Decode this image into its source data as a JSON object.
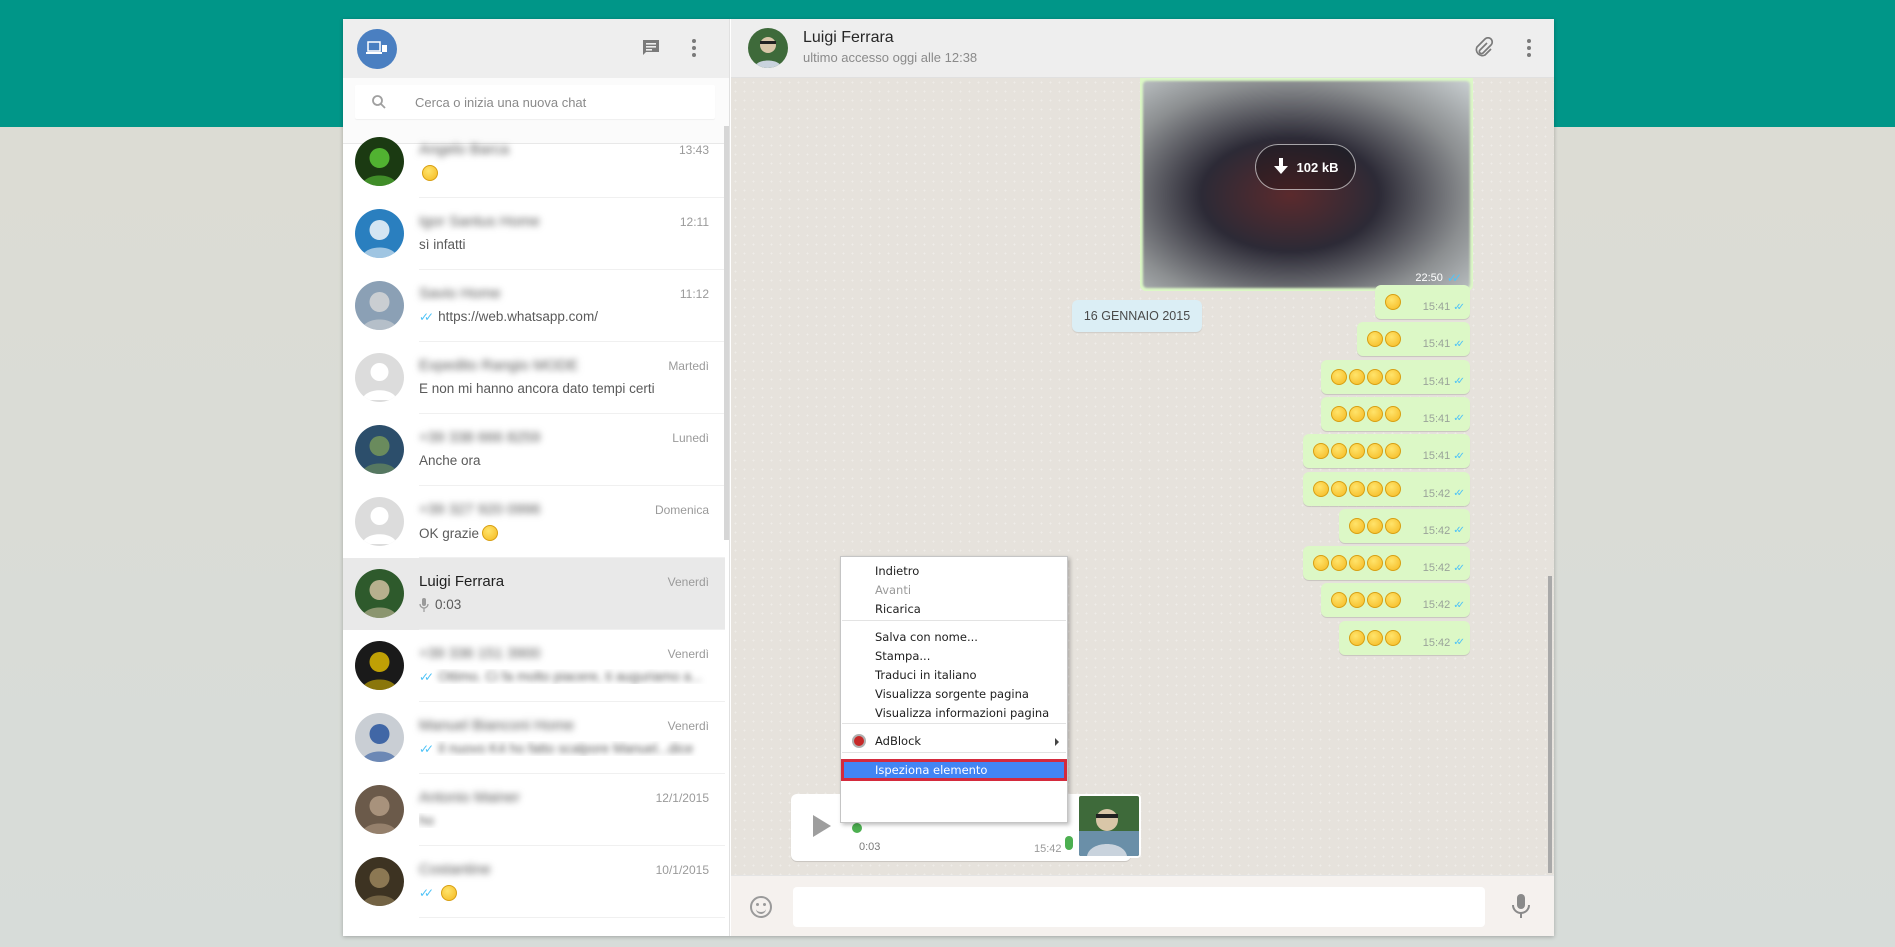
{
  "sidebar": {
    "search_placeholder": "Cerca o inizia una nuova chat",
    "chats": [
      {
        "name": "Angelo Barca",
        "time": "13:43",
        "message": "",
        "has_emoji": true,
        "ticks": false,
        "blurred_name": true,
        "avatar_color": "#1b3a12",
        "avatar_color2": "#5fd13a"
      },
      {
        "name": "Igor Santus Home",
        "time": "12:11",
        "message": "sì infatti",
        "has_emoji": false,
        "ticks": false,
        "blurred_name": true,
        "avatar_color": "#2a7fbf",
        "avatar_color2": "#ffffff"
      },
      {
        "name": "Savio Home",
        "time": "11:12",
        "message": "https://web.whatsapp.com/",
        "has_emoji": false,
        "ticks": true,
        "blurred_name": true,
        "avatar_color": "#8ba0b5",
        "avatar_color2": "#d9d9d9"
      },
      {
        "name": "Expedito Rangio MODE",
        "time": "Martedì",
        "message": "E non mi hanno ancora dato tempi certi",
        "has_emoji": false,
        "ticks": false,
        "blurred_name": true,
        "avatar_color": "#dcdcdc",
        "avatar_color2": "#ffffff"
      },
      {
        "name": "+39 338 666 8259",
        "time": "Lunedì",
        "message": "Anche ora",
        "has_emoji": false,
        "ticks": false,
        "blurred_name": true,
        "avatar_color": "#2c4e6b",
        "avatar_color2": "#7a9b5a"
      },
      {
        "name": "+39 327 920 0996",
        "time": "Domenica",
        "message": "OK grazie",
        "has_emoji": true,
        "ticks": false,
        "blurred_name": true,
        "avatar_color": "#dcdcdc",
        "avatar_color2": "#ffffff"
      },
      {
        "name": "Luigi Ferrara",
        "time": "Venerdì",
        "message": "0:03",
        "has_emoji": false,
        "ticks": false,
        "blurred_name": false,
        "avatar_color": "#2e5a2c",
        "avatar_color2": "#d9c6a8"
      },
      {
        "name": "+39 336 151 3900",
        "time": "Venerdì",
        "message": "Ottimo. Ci fa molto piacere, ti auguriamo a...",
        "has_emoji": false,
        "ticks": true,
        "blurred_name": true,
        "blurred_msg": true,
        "avatar_color": "#1a1a1a",
        "avatar_color2": "#e8c200"
      },
      {
        "name": "Manuel Bianconi Home",
        "time": "Venerdì",
        "message": "Il nuovo K4 ho fatto scalpore Manuel...dice",
        "has_emoji": false,
        "ticks": true,
        "blurred_name": true,
        "blurred_msg": true,
        "avatar_color": "#c9ced4",
        "avatar_color2": "#1f4e9a"
      },
      {
        "name": "Antonio Mainer",
        "time": "12/1/2015",
        "message": "ho",
        "has_emoji": false,
        "ticks": false,
        "blurred_name": true,
        "blurred_msg": true,
        "avatar_color": "#6b5a4a",
        "avatar_color2": "#b8a088"
      },
      {
        "name": "Costantine",
        "time": "10/1/2015",
        "message": "",
        "has_emoji": true,
        "ticks": true,
        "blurred_name": true,
        "avatar_color": "#3d3322",
        "avatar_color2": "#a08a60"
      }
    ]
  },
  "conversation": {
    "contact_name": "Luigi Ferrara",
    "contact_status": "ultimo accesso oggi alle 12:38",
    "image_message": {
      "size_label": "102 kB",
      "time": "22:50"
    },
    "date_chip": "16 GENNAIO 2015",
    "bubbles": [
      {
        "time": "15:41",
        "emoji_count": 1
      },
      {
        "time": "15:41",
        "emoji_count": 2
      },
      {
        "time": "15:41",
        "emoji_count": 4
      },
      {
        "time": "15:41",
        "emoji_count": 4
      },
      {
        "time": "15:41",
        "emoji_count": 5
      },
      {
        "time": "15:42",
        "emoji_count": 5
      },
      {
        "time": "15:42",
        "emoji_count": 3
      },
      {
        "time": "15:42",
        "emoji_count": 5
      },
      {
        "time": "15:42",
        "emoji_count": 4
      },
      {
        "time": "15:42",
        "emoji_count": 3
      }
    ],
    "voice_message": {
      "duration": "0:03",
      "time": "15:42"
    }
  },
  "context_menu": {
    "items": [
      {
        "label": "Indietro",
        "disabled": false
      },
      {
        "label": "Avanti",
        "disabled": true
      },
      {
        "label": "Ricarica",
        "disabled": false
      },
      {
        "label": "Salva con nome...",
        "disabled": false
      },
      {
        "label": "Stampa...",
        "disabled": false
      },
      {
        "label": "Traduci in italiano",
        "disabled": false
      },
      {
        "label": "Visualizza sorgente pagina",
        "disabled": false
      },
      {
        "label": "Visualizza informazioni pagina",
        "disabled": false
      },
      {
        "label": "AdBlock",
        "disabled": false
      },
      {
        "label": "Ispeziona elemento",
        "disabled": false
      }
    ]
  },
  "colors": {
    "accent": "#009688",
    "bubble_out": "#dcf8c6",
    "ticks": "#4fc3f7",
    "highlight": "#4285f4",
    "highlight_border": "#d42a3d"
  }
}
